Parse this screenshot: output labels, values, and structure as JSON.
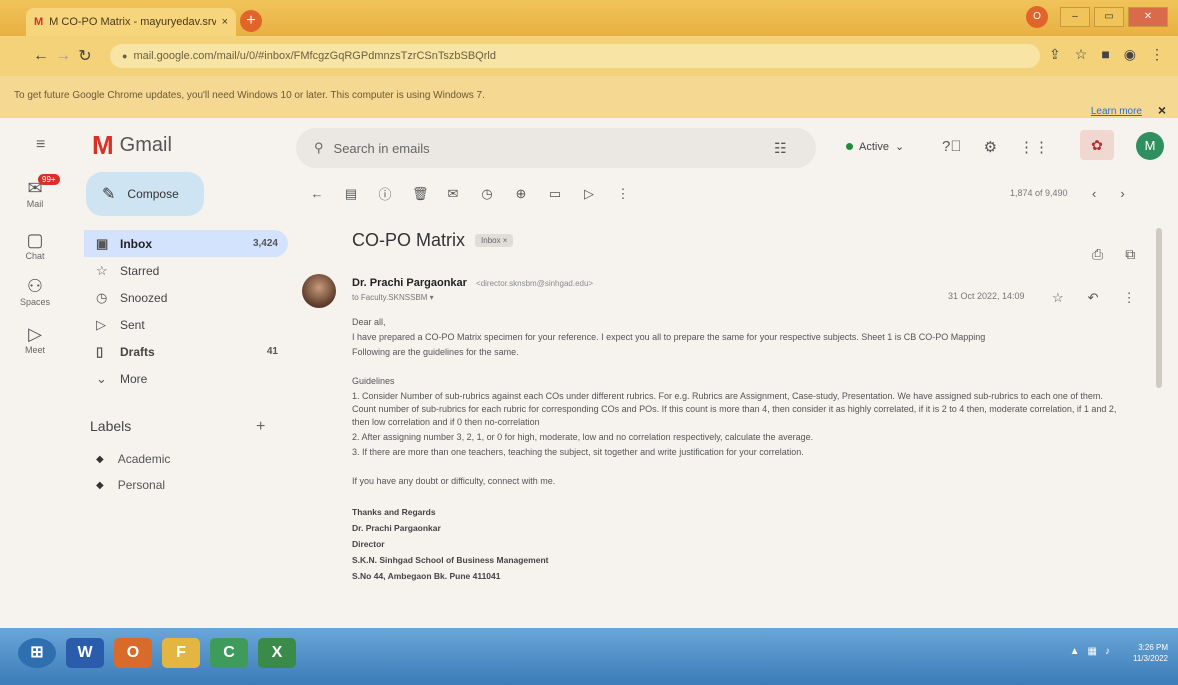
{
  "browser": {
    "tab_title": "M CO-PO Matrix - mayuryedav.srv",
    "tab_favicon": "M",
    "tab_close": "×",
    "new_tab": "+",
    "url": "mail.google.com/mail/u/0/#inbox/FMfcgzGqRGPdmnzsTzrCSnTszbSBQrld",
    "profile_initial": "O",
    "info_message": "To get future Google Chrome updates, you'll need Windows 10 or later. This computer is using Windows 7.",
    "learn_more": "Learn more",
    "info_close": "×"
  },
  "gmail": {
    "logo_text": "Gmail",
    "compose_label": "Compose",
    "search_placeholder": "Search in emails",
    "status": "Active",
    "user_initial": "M",
    "rail": [
      {
        "label": "Mail",
        "badge": "99+"
      },
      {
        "label": "Chat"
      },
      {
        "label": "Spaces"
      },
      {
        "label": "Meet"
      }
    ],
    "nav": [
      {
        "label": "Inbox",
        "count": "3,424"
      },
      {
        "label": "Starred",
        "count": ""
      },
      {
        "label": "Snoozed",
        "count": ""
      },
      {
        "label": "Sent",
        "count": ""
      },
      {
        "label": "Drafts",
        "count": "41"
      },
      {
        "label": "More",
        "count": ""
      }
    ],
    "labels_heading": "Labels",
    "labels": [
      "Academic",
      "Personal"
    ],
    "pager": "1,874 of 9,490"
  },
  "message": {
    "subject": "CO-PO Matrix",
    "chip": "Inbox ×",
    "sender_name": "Dr. Prachi Pargaonkar",
    "sender_email": "<director.sknsbm@sinhgad.edu>",
    "to": "to Faculty.SKNSSBM ▾",
    "date": "31 Oct 2022, 14:09",
    "greeting": "Dear all,",
    "para1": "I have prepared a CO-PO Matrix specimen for your reference. I expect you all to prepare the same for your respective subjects. Sheet 1 is CB CO-PO Mapping",
    "para2": "Following are the guidelines for the same.",
    "guidelines_heading": "Guidelines",
    "g1": "1. Consider Number of sub-rubrics against each COs under different rubrics. For e.g. Rubrics are Assignment, Case-study, Presentation. We have assigned sub-rubrics to each one of them. Count number of sub-rubrics for each rubric for corresponding COs and POs. If this count is more than 4, then consider it as highly correlated, if it is 2 to 4 then, moderate correlation, if 1 and 2, then low correlation and if 0 then no-correlation",
    "g2": "2. After assigning number 3, 2, 1, or 0 for high, moderate, low and no correlation respectively, calculate the average.",
    "g3": "3. If there are more than one teachers, teaching the subject, sit together and write justification for your correlation.",
    "closing": "If you have any doubt or difficulty, connect with me.",
    "sig1": "Thanks and Regards",
    "sig2": "Dr. Prachi Pargaonkar",
    "sig3": "Director",
    "sig4": "S.K.N. Sinhgad School of Business Management",
    "sig5": "S.No 44, Ambegaon Bk. Pune 411041"
  },
  "taskbar": {
    "time": "3:26 PM",
    "date": "11/3/2022",
    "items": [
      "W",
      "O",
      "F",
      "C",
      "X"
    ]
  }
}
